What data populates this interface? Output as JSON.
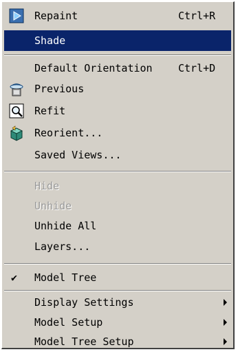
{
  "menu": {
    "items": [
      {
        "label": "Repaint",
        "shortcut": "Ctrl+R",
        "icon": "repaint-icon"
      },
      {
        "label": "Shade",
        "selected": true
      },
      {
        "label": "Default Orientation",
        "shortcut": "Ctrl+D"
      },
      {
        "label": "Previous",
        "icon": "previous-view-icon"
      },
      {
        "label": "Refit",
        "icon": "refit-magnifier-icon"
      },
      {
        "label": "Reorient...",
        "icon": "reorient-icon"
      },
      {
        "label": "Saved Views..."
      },
      {
        "label": "Hide",
        "disabled": true
      },
      {
        "label": "Unhide",
        "disabled": true
      },
      {
        "label": "Unhide All"
      },
      {
        "label": "Layers..."
      },
      {
        "label": "Model Tree",
        "checked": true
      },
      {
        "label": "Display Settings",
        "submenu": true
      },
      {
        "label": "Model Setup",
        "submenu": true
      },
      {
        "label": "Model Tree Setup",
        "submenu": true
      }
    ],
    "check_mark": "✔",
    "colors": {
      "background": "#d4d0c8",
      "selection": "#0a246a",
      "disabled_text": "#9a9a9a"
    }
  }
}
